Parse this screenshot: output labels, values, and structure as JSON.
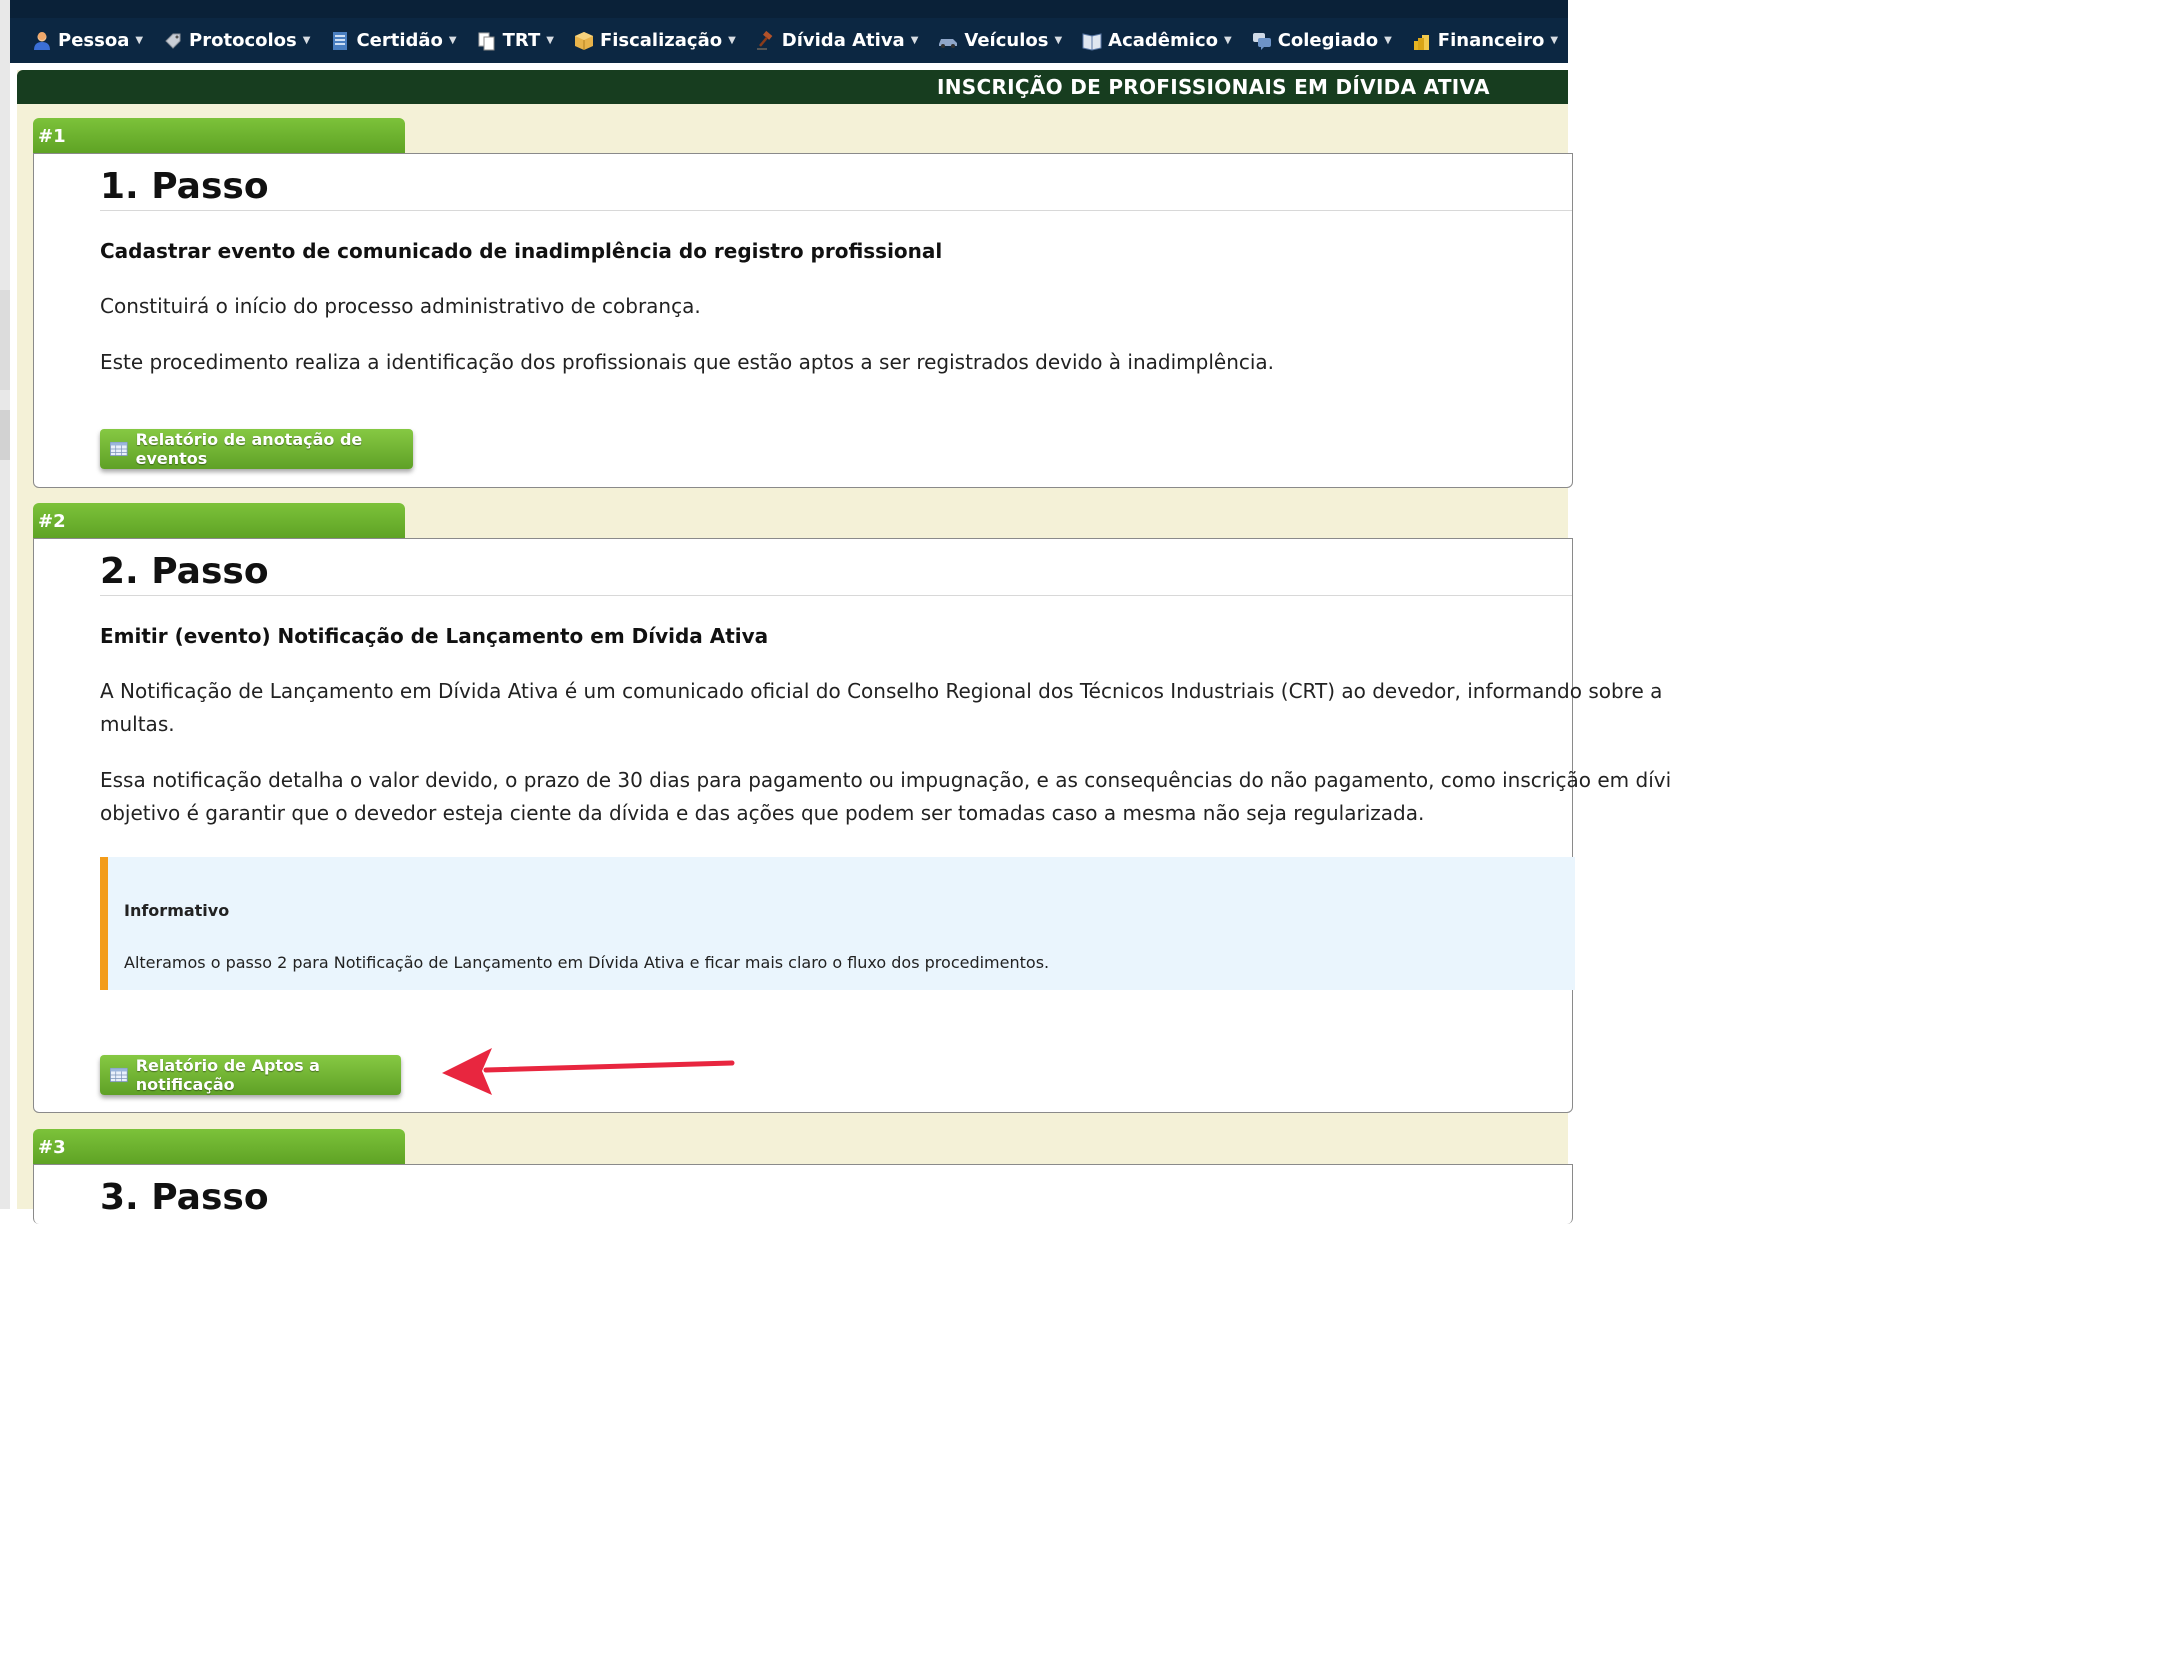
{
  "nav": {
    "items": [
      {
        "label": "Pessoa",
        "icon": "person-icon"
      },
      {
        "label": "Protocolos",
        "icon": "tag-icon"
      },
      {
        "label": "Certidão",
        "icon": "document-icon"
      },
      {
        "label": "TRT",
        "icon": "copies-icon"
      },
      {
        "label": "Fiscalização",
        "icon": "box-icon"
      },
      {
        "label": "Dívida Ativa",
        "icon": "gavel-icon"
      },
      {
        "label": "Veículos",
        "icon": "car-icon"
      },
      {
        "label": "Acadêmico",
        "icon": "book-icon"
      },
      {
        "label": "Colegiado",
        "icon": "chat-icon"
      },
      {
        "label": "Financeiro",
        "icon": "coins-icon"
      }
    ]
  },
  "page": {
    "title": "INSCRIÇÃO DE PROFISSIONAIS EM DÍVIDA ATIVA"
  },
  "steps": [
    {
      "tab": "#1",
      "heading": "1. Passo",
      "subtitle": "Cadastrar evento de comunicado de inadimplência do registro profissional",
      "paragraphs": [
        "Constituirá o início do processo administrativo de cobrança.",
        "Este procedimento realiza a identificação dos profissionais que estão aptos a ser registrados devido à inadimplência."
      ],
      "button": "Relatório de anotação de eventos"
    },
    {
      "tab": "#2",
      "heading": "2. Passo",
      "subtitle": "Emitir (evento) Notificação de Lançamento em Dívida Ativa",
      "paragraphs": [
        "A Notificação de Lançamento em Dívida Ativa é um comunicado oficial do Conselho Regional dos Técnicos Industriais (CRT) ao devedor, informando sobre a",
        "multas.",
        "Essa notificação detalha o valor devido, o prazo de 30 dias para pagamento ou impugnação, e as consequências do não pagamento, como inscrição em dívi",
        "objetivo é garantir que o devedor esteja ciente da dívida e das ações que podem ser tomadas caso a mesma não seja regularizada."
      ],
      "info": {
        "title": "Informativo",
        "text": "Alteramos o passo 2 para Notificação de Lançamento em Dívida Ativa e ficar mais claro o fluxo dos procedimentos."
      },
      "button": "Relatório de Aptos a notificação"
    },
    {
      "tab": "#3",
      "heading": "3. Passo"
    }
  ],
  "colors": {
    "nav_bg": "#0c2742",
    "header_bg": "#173d1f",
    "tab_green": "#6db12e",
    "page_bg": "#f4f1d7",
    "info_border": "#f39c1a",
    "info_bg": "#eaf5fd",
    "arrow": "#e8263f"
  }
}
